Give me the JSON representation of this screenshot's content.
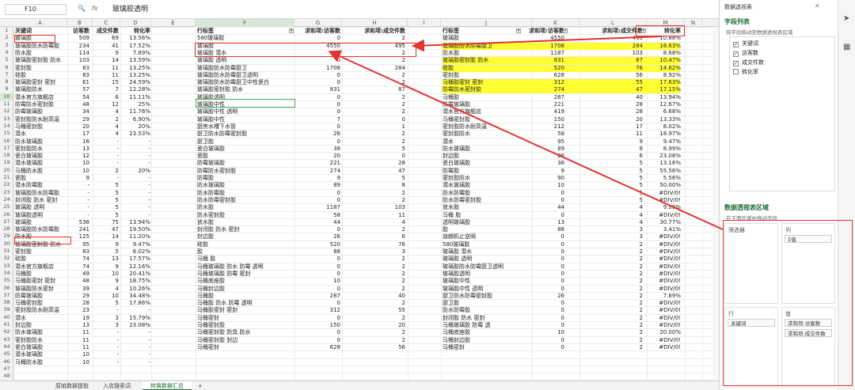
{
  "formula_bar": {
    "name_box": "F10",
    "fx_label": "fx",
    "value": "玻璃胶透明"
  },
  "columns": [
    "A",
    "B",
    "C",
    "D",
    "E",
    "F",
    "G",
    "H",
    "I",
    "J",
    "K",
    "L",
    "M",
    "N"
  ],
  "selected_column": "F",
  "rows": [
    "1",
    "2",
    "3",
    "4",
    "5",
    "6",
    "7",
    "8",
    "9",
    "10",
    "11",
    "12",
    "13",
    "14",
    "15",
    "16",
    "17",
    "18",
    "19",
    "20",
    "21",
    "22",
    "23",
    "24",
    "25",
    "26",
    "27",
    "28",
    "29",
    "30",
    "31",
    "32",
    "33",
    "34",
    "35",
    "36",
    "37",
    "38",
    "39",
    "40",
    "41",
    "42",
    "43",
    "44",
    "45",
    "46",
    "47",
    "48",
    "49",
    "50"
  ],
  "selected_row": "10",
  "left_table": {
    "headers": [
      "关键词",
      "访客数",
      "成交件数",
      "转化率"
    ],
    "rows": [
      [
        "玻璃胶",
        "509",
        "69",
        "13.56%"
      ],
      [
        "玻璃胶防水防霉胶",
        "234",
        "41",
        "17.52%"
      ],
      [
        "防水胶",
        "114",
        "9",
        "7.89%"
      ],
      [
        "玻璃胶密封胶 防水",
        "103",
        "14",
        "13.59%"
      ],
      [
        "密封胶",
        "83",
        "11",
        "13.25%"
      ],
      [
        "硅胶",
        "83",
        "11",
        "13.25%"
      ],
      [
        "玻璃胶密封 密封",
        "61",
        "15",
        "24.59%"
      ],
      [
        "玻璃胶防水",
        "57",
        "7",
        "12.28%"
      ],
      [
        "潜水官方旗舰店",
        "54",
        "6",
        "11.11%"
      ],
      [
        "防霉防水密封胶",
        "48",
        "12",
        "25%"
      ],
      [
        "防霉玻璃胶",
        "34",
        "4",
        "11.76%"
      ],
      [
        "密封胶防水耐高温",
        "29",
        "2",
        "6.90%"
      ],
      [
        "马桶密封胶",
        "20",
        "4",
        "20%"
      ],
      [
        "潜水",
        "17",
        "4",
        "23.53%"
      ],
      [
        "防水玻璃胶",
        "16",
        "-",
        "-"
      ],
      [
        "密封胶防水",
        "13",
        "-",
        "-"
      ],
      [
        "瓷白玻璃胶",
        "12",
        "-",
        "-"
      ],
      [
        "潜水玻璃胶",
        "10",
        "-",
        "-"
      ],
      [
        "马桶防水胶",
        "10",
        "2",
        "20%"
      ],
      [
        "瓷胶",
        "9",
        "-",
        "-"
      ],
      [
        "潜水防霉胶",
        "-",
        "5",
        "-"
      ],
      [
        "玻璃胶防水防霉胶",
        "-",
        "5",
        "-"
      ],
      [
        "封闭胶 防水 密封",
        "-",
        "5",
        "-"
      ],
      [
        "玻璃胶 透明",
        "-",
        "5",
        "-"
      ],
      [
        "玻璃胶透明",
        "-",
        "5",
        "-"
      ],
      [
        "玻璃胶",
        "538",
        "75",
        "13.94%"
      ],
      [
        "玻璃胶防水防霉胶",
        "241",
        "47",
        "19.50%"
      ],
      [
        "防水胶",
        "125",
        "14",
        "11.20%"
      ],
      [
        "玻璃胶密封胶 防水",
        "95",
        "9",
        "9.47%"
      ],
      [
        "密封胶",
        "83",
        "5",
        "6.02%"
      ],
      [
        "硅胶",
        "74",
        "13",
        "17.57%"
      ],
      [
        "潜水官方旗舰店",
        "74",
        "9",
        "12.16%"
      ],
      [
        "马桶胶",
        "49",
        "10",
        "20.41%"
      ],
      [
        "马桶胶密封 密封",
        "48",
        "9",
        "18.75%"
      ],
      [
        "玻璃胶防水密封",
        "39",
        "4",
        "10.26%"
      ],
      [
        "防霉玻璃胶",
        "29",
        "10",
        "34.48%"
      ],
      [
        "马桶密封胶",
        "28",
        "5",
        "17.86%"
      ],
      [
        "密封胶防水耐高温",
        "23",
        "-",
        "-"
      ],
      [
        "潜水",
        "19",
        "3",
        "15.79%"
      ],
      [
        "封边胶",
        "13",
        "3",
        "23.08%"
      ],
      [
        "防水玻璃胶",
        "11",
        "-",
        "-"
      ],
      [
        "密封胶防水",
        "11",
        "-",
        "-"
      ],
      [
        "瓷白玻璃胶",
        "11",
        "-",
        "-"
      ],
      [
        "潜水玻璃胶",
        "10",
        "-",
        "-"
      ],
      [
        "马桶防水胶",
        "10",
        "-",
        "-"
      ]
    ]
  },
  "pivot_mid": {
    "headers": [
      "行标签",
      "求和项:访客数",
      "求和项:成交件数"
    ],
    "rows": [
      [
        "580玻璃胶",
        "0",
        "2"
      ],
      [
        "玻璃胶",
        "4550",
        "495"
      ],
      [
        "玻璃胶 潜水",
        "0",
        "2"
      ],
      [
        "玻璃胶 透明",
        "0",
        "2"
      ],
      [
        "玻璃胶防水防霉厨卫",
        "1708",
        "284"
      ],
      [
        "玻璃胶防水防霉厨卫透明",
        "0",
        "2"
      ],
      [
        "玻璃胶防水防霉厨卫中性瓷白",
        "0",
        "2"
      ],
      [
        "玻璃胶密封胶 防水",
        "831",
        "87"
      ],
      [
        "玻璃胶透明",
        "0",
        "2"
      ],
      [
        "玻璃胶中性",
        "0",
        "2"
      ],
      [
        "玻璃胶中性 透明",
        "0",
        "2"
      ],
      [
        "玻璃胶中性",
        "7",
        "0"
      ],
      [
        "厨房水槽下水管",
        "0",
        "1"
      ],
      [
        "厨卫防水防霉密封胶",
        "26",
        "2"
      ],
      [
        "厨卫胶",
        "0",
        "2"
      ],
      [
        "瓷白玻璃胶",
        "38",
        "5"
      ],
      [
        "瓷胶",
        "20",
        "0"
      ],
      [
        "防霉玻璃胶",
        "221",
        "28"
      ],
      [
        "防霉防水密封胶",
        "274",
        "47"
      ],
      [
        "防霉胶",
        "9",
        "5"
      ],
      [
        "防水玻璃胶",
        "89",
        "8"
      ],
      [
        "防水防霉胶",
        "0",
        "2"
      ],
      [
        "防水防霉密封胶",
        "0",
        "2"
      ],
      [
        "防水胶",
        "1187",
        "103"
      ],
      [
        "防水密封胶",
        "58",
        "11"
      ],
      [
        "放水胶",
        "44",
        "4"
      ],
      [
        "封闭胶 防水 密封",
        "0",
        "2"
      ],
      [
        "封边胶",
        "26",
        "6"
      ],
      [
        "硅胶",
        "520",
        "76"
      ],
      [
        "胶",
        "88",
        "3"
      ],
      [
        "马桶 胶",
        "0",
        "2"
      ],
      [
        "马桶玻璃胶 防水 防霉 透明",
        "0",
        "2"
      ],
      [
        "马桶玻璃胶 防霉 密封",
        "0",
        "2"
      ],
      [
        "马桶底座胶",
        "10",
        "2"
      ],
      [
        "马桶封边胶",
        "0",
        "2"
      ],
      [
        "马桶胶",
        "287",
        "40"
      ],
      [
        "马桶胶 防水 防霉 透明",
        "0",
        "2"
      ],
      [
        "马桶胶密封 密封",
        "312",
        "55"
      ],
      [
        "马桶密封",
        "0",
        "2"
      ],
      [
        "马桶密封胶",
        "150",
        "20"
      ],
      [
        "马桶密封胶 防臭 防水",
        "0",
        "2"
      ],
      [
        "马桶密封胶 封边",
        "0",
        "2"
      ],
      [
        "马桶密封",
        "628",
        "56"
      ]
    ]
  },
  "pivot_right": {
    "headers": [
      "行标签",
      "求和项:访客数",
      "求和项:成交件数",
      "转化率"
    ],
    "rows": [
      [
        "玻璃胶",
        "4550",
        "495",
        "10.88%"
      ],
      [
        "玻璃胶防水防霉厨卫",
        "1708",
        "284",
        "16.63%"
      ],
      [
        "防水胶",
        "1187",
        "103",
        "8.68%"
      ],
      [
        "玻璃胶密封胶 防水",
        "831",
        "87",
        "10.47%"
      ],
      [
        "硅胶",
        "520",
        "76",
        "14.62%"
      ],
      [
        "密封胶",
        "628",
        "56",
        "8.92%"
      ],
      [
        "马桶胶密封 密封",
        "312",
        "55",
        "17.63%"
      ],
      [
        "防霉防水密封胶",
        "274",
        "47",
        "17.15%"
      ],
      [
        "马桶胶",
        "287",
        "40",
        "13.94%"
      ],
      [
        "防霉玻璃胶",
        "221",
        "28",
        "12.67%"
      ],
      [
        "潜水官方旗舰店",
        "419",
        "28",
        "6.68%"
      ],
      [
        "马桶密封胶",
        "150",
        "20",
        "13.33%"
      ],
      [
        "密封胶防水耐高温",
        "212",
        "17",
        "8.02%"
      ],
      [
        "密封胶防水",
        "58",
        "11",
        "18.97%"
      ],
      [
        "潜水",
        "95",
        "9",
        "9.47%"
      ],
      [
        "防水玻璃胶",
        "89",
        "8",
        "8.99%"
      ],
      [
        "封边胶",
        "26",
        "6",
        "23.08%"
      ],
      [
        "瓷白玻璃胶",
        "38",
        "5",
        "13.16%"
      ],
      [
        "防霉胶",
        "9",
        "5",
        "55.56%"
      ],
      [
        "密封胶防水",
        "90",
        "5",
        "5.56%"
      ],
      [
        "潜水玻璃胶",
        "10",
        "5",
        "50.00%"
      ],
      [
        "防水防霉胶",
        "0",
        "5",
        "#DIV/0!"
      ],
      [
        "防水防霉密封胶",
        "0",
        "5",
        "#DIV/0!"
      ],
      [
        "放水胶",
        "44",
        "4",
        "9.09%"
      ],
      [
        "马桶 胶",
        "0",
        "4",
        "#DIV/0!"
      ],
      [
        "透明玻璃胶",
        "13",
        "4",
        "30.77%"
      ],
      [
        "胶",
        "88",
        "3",
        "3.41%"
      ],
      [
        "迪朗机止逆阀",
        "0",
        "3",
        "#DIV/0!"
      ],
      [
        "580玻璃胶",
        "0",
        "2",
        "#DIV/0!"
      ],
      [
        "玻璃胶 潜水",
        "0",
        "2",
        "#DIV/0!"
      ],
      [
        "玻璃胶 透明",
        "0",
        "2",
        "#DIV/0!"
      ],
      [
        "玻璃胶防水防霉厨卫透明",
        "0",
        "2",
        "#DIV/0!"
      ],
      [
        "玻璃胶透明",
        "0",
        "2",
        "#DIV/0!"
      ],
      [
        "玻璃胶中性",
        "0",
        "2",
        "#DIV/0!"
      ],
      [
        "玻璃胶中性 透明",
        "0",
        "2",
        "#DIV/0!"
      ],
      [
        "厨卫防水防霉密封胶",
        "26",
        "2",
        "7.69%"
      ],
      [
        "厨卫胶",
        "0",
        "2",
        "#DIV/0!"
      ],
      [
        "防水防霉胶",
        "0",
        "2",
        "#DIV/0!"
      ],
      [
        "封闭胶 防水 密封",
        "0",
        "2",
        "#DIV/0!"
      ],
      [
        "马桶玻璃胶 防霉 透",
        "0",
        "2",
        "#DIV/0!"
      ],
      [
        "马桶底座胶",
        "10",
        "2",
        "20.00%"
      ],
      [
        "马桶封边胶",
        "0",
        "2",
        "#DIV/0!"
      ],
      [
        "马桶密封",
        "0",
        "2",
        "#DIV/0!"
      ]
    ]
  },
  "highlight_color": "#ffff33",
  "accent_color": "#1e6b35",
  "annotation_color": "#e3342f",
  "sheet_tabs": [
    "原始数据提取",
    "入店搜索词",
    "转换数据汇总"
  ],
  "active_tab": "转换数据汇总",
  "add_tab_label": "+",
  "panel": {
    "title": "数据透视表",
    "field_list_title": "字段列表",
    "field_list_hint": "将字段拖动至数据透视表区域",
    "fields": [
      {
        "label": "关键词",
        "checked": true
      },
      {
        "label": "访客数",
        "checked": true
      },
      {
        "label": "成交件数",
        "checked": true
      },
      {
        "label": "转化率",
        "checked": false
      }
    ],
    "areas_title": "数据透视表区域",
    "areas_hint": "在下面区域中拖动字段",
    "filter_label": "筛选器",
    "columns_label": "列",
    "columns_item": "Σ值",
    "rows_label": "行",
    "rows_item": "关键词",
    "values_label": "值",
    "values_items": [
      "求和项:访客数",
      "求和项:成交件数"
    ]
  }
}
